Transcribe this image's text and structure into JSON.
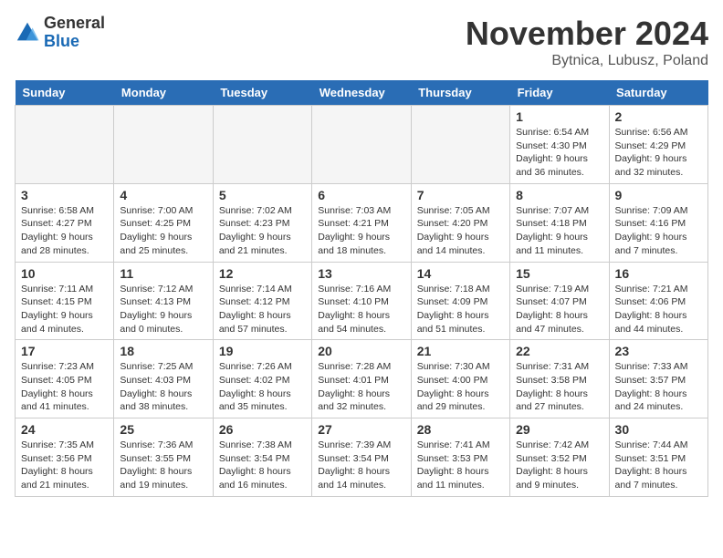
{
  "header": {
    "logo_general": "General",
    "logo_blue": "Blue",
    "month_year": "November 2024",
    "location": "Bytnica, Lubusz, Poland"
  },
  "days_of_week": [
    "Sunday",
    "Monday",
    "Tuesday",
    "Wednesday",
    "Thursday",
    "Friday",
    "Saturday"
  ],
  "weeks": [
    [
      {
        "day": "",
        "info": "",
        "empty": true
      },
      {
        "day": "",
        "info": "",
        "empty": true
      },
      {
        "day": "",
        "info": "",
        "empty": true
      },
      {
        "day": "",
        "info": "",
        "empty": true
      },
      {
        "day": "",
        "info": "",
        "empty": true
      },
      {
        "day": "1",
        "info": "Sunrise: 6:54 AM\nSunset: 4:30 PM\nDaylight: 9 hours\nand 36 minutes."
      },
      {
        "day": "2",
        "info": "Sunrise: 6:56 AM\nSunset: 4:29 PM\nDaylight: 9 hours\nand 32 minutes."
      }
    ],
    [
      {
        "day": "3",
        "info": "Sunrise: 6:58 AM\nSunset: 4:27 PM\nDaylight: 9 hours\nand 28 minutes."
      },
      {
        "day": "4",
        "info": "Sunrise: 7:00 AM\nSunset: 4:25 PM\nDaylight: 9 hours\nand 25 minutes."
      },
      {
        "day": "5",
        "info": "Sunrise: 7:02 AM\nSunset: 4:23 PM\nDaylight: 9 hours\nand 21 minutes."
      },
      {
        "day": "6",
        "info": "Sunrise: 7:03 AM\nSunset: 4:21 PM\nDaylight: 9 hours\nand 18 minutes."
      },
      {
        "day": "7",
        "info": "Sunrise: 7:05 AM\nSunset: 4:20 PM\nDaylight: 9 hours\nand 14 minutes."
      },
      {
        "day": "8",
        "info": "Sunrise: 7:07 AM\nSunset: 4:18 PM\nDaylight: 9 hours\nand 11 minutes."
      },
      {
        "day": "9",
        "info": "Sunrise: 7:09 AM\nSunset: 4:16 PM\nDaylight: 9 hours\nand 7 minutes."
      }
    ],
    [
      {
        "day": "10",
        "info": "Sunrise: 7:11 AM\nSunset: 4:15 PM\nDaylight: 9 hours\nand 4 minutes."
      },
      {
        "day": "11",
        "info": "Sunrise: 7:12 AM\nSunset: 4:13 PM\nDaylight: 9 hours\nand 0 minutes."
      },
      {
        "day": "12",
        "info": "Sunrise: 7:14 AM\nSunset: 4:12 PM\nDaylight: 8 hours\nand 57 minutes."
      },
      {
        "day": "13",
        "info": "Sunrise: 7:16 AM\nSunset: 4:10 PM\nDaylight: 8 hours\nand 54 minutes."
      },
      {
        "day": "14",
        "info": "Sunrise: 7:18 AM\nSunset: 4:09 PM\nDaylight: 8 hours\nand 51 minutes."
      },
      {
        "day": "15",
        "info": "Sunrise: 7:19 AM\nSunset: 4:07 PM\nDaylight: 8 hours\nand 47 minutes."
      },
      {
        "day": "16",
        "info": "Sunrise: 7:21 AM\nSunset: 4:06 PM\nDaylight: 8 hours\nand 44 minutes."
      }
    ],
    [
      {
        "day": "17",
        "info": "Sunrise: 7:23 AM\nSunset: 4:05 PM\nDaylight: 8 hours\nand 41 minutes."
      },
      {
        "day": "18",
        "info": "Sunrise: 7:25 AM\nSunset: 4:03 PM\nDaylight: 8 hours\nand 38 minutes."
      },
      {
        "day": "19",
        "info": "Sunrise: 7:26 AM\nSunset: 4:02 PM\nDaylight: 8 hours\nand 35 minutes."
      },
      {
        "day": "20",
        "info": "Sunrise: 7:28 AM\nSunset: 4:01 PM\nDaylight: 8 hours\nand 32 minutes."
      },
      {
        "day": "21",
        "info": "Sunrise: 7:30 AM\nSunset: 4:00 PM\nDaylight: 8 hours\nand 29 minutes."
      },
      {
        "day": "22",
        "info": "Sunrise: 7:31 AM\nSunset: 3:58 PM\nDaylight: 8 hours\nand 27 minutes."
      },
      {
        "day": "23",
        "info": "Sunrise: 7:33 AM\nSunset: 3:57 PM\nDaylight: 8 hours\nand 24 minutes."
      }
    ],
    [
      {
        "day": "24",
        "info": "Sunrise: 7:35 AM\nSunset: 3:56 PM\nDaylight: 8 hours\nand 21 minutes."
      },
      {
        "day": "25",
        "info": "Sunrise: 7:36 AM\nSunset: 3:55 PM\nDaylight: 8 hours\nand 19 minutes."
      },
      {
        "day": "26",
        "info": "Sunrise: 7:38 AM\nSunset: 3:54 PM\nDaylight: 8 hours\nand 16 minutes."
      },
      {
        "day": "27",
        "info": "Sunrise: 7:39 AM\nSunset: 3:54 PM\nDaylight: 8 hours\nand 14 minutes."
      },
      {
        "day": "28",
        "info": "Sunrise: 7:41 AM\nSunset: 3:53 PM\nDaylight: 8 hours\nand 11 minutes."
      },
      {
        "day": "29",
        "info": "Sunrise: 7:42 AM\nSunset: 3:52 PM\nDaylight: 8 hours\nand 9 minutes."
      },
      {
        "day": "30",
        "info": "Sunrise: 7:44 AM\nSunset: 3:51 PM\nDaylight: 8 hours\nand 7 minutes."
      }
    ]
  ]
}
